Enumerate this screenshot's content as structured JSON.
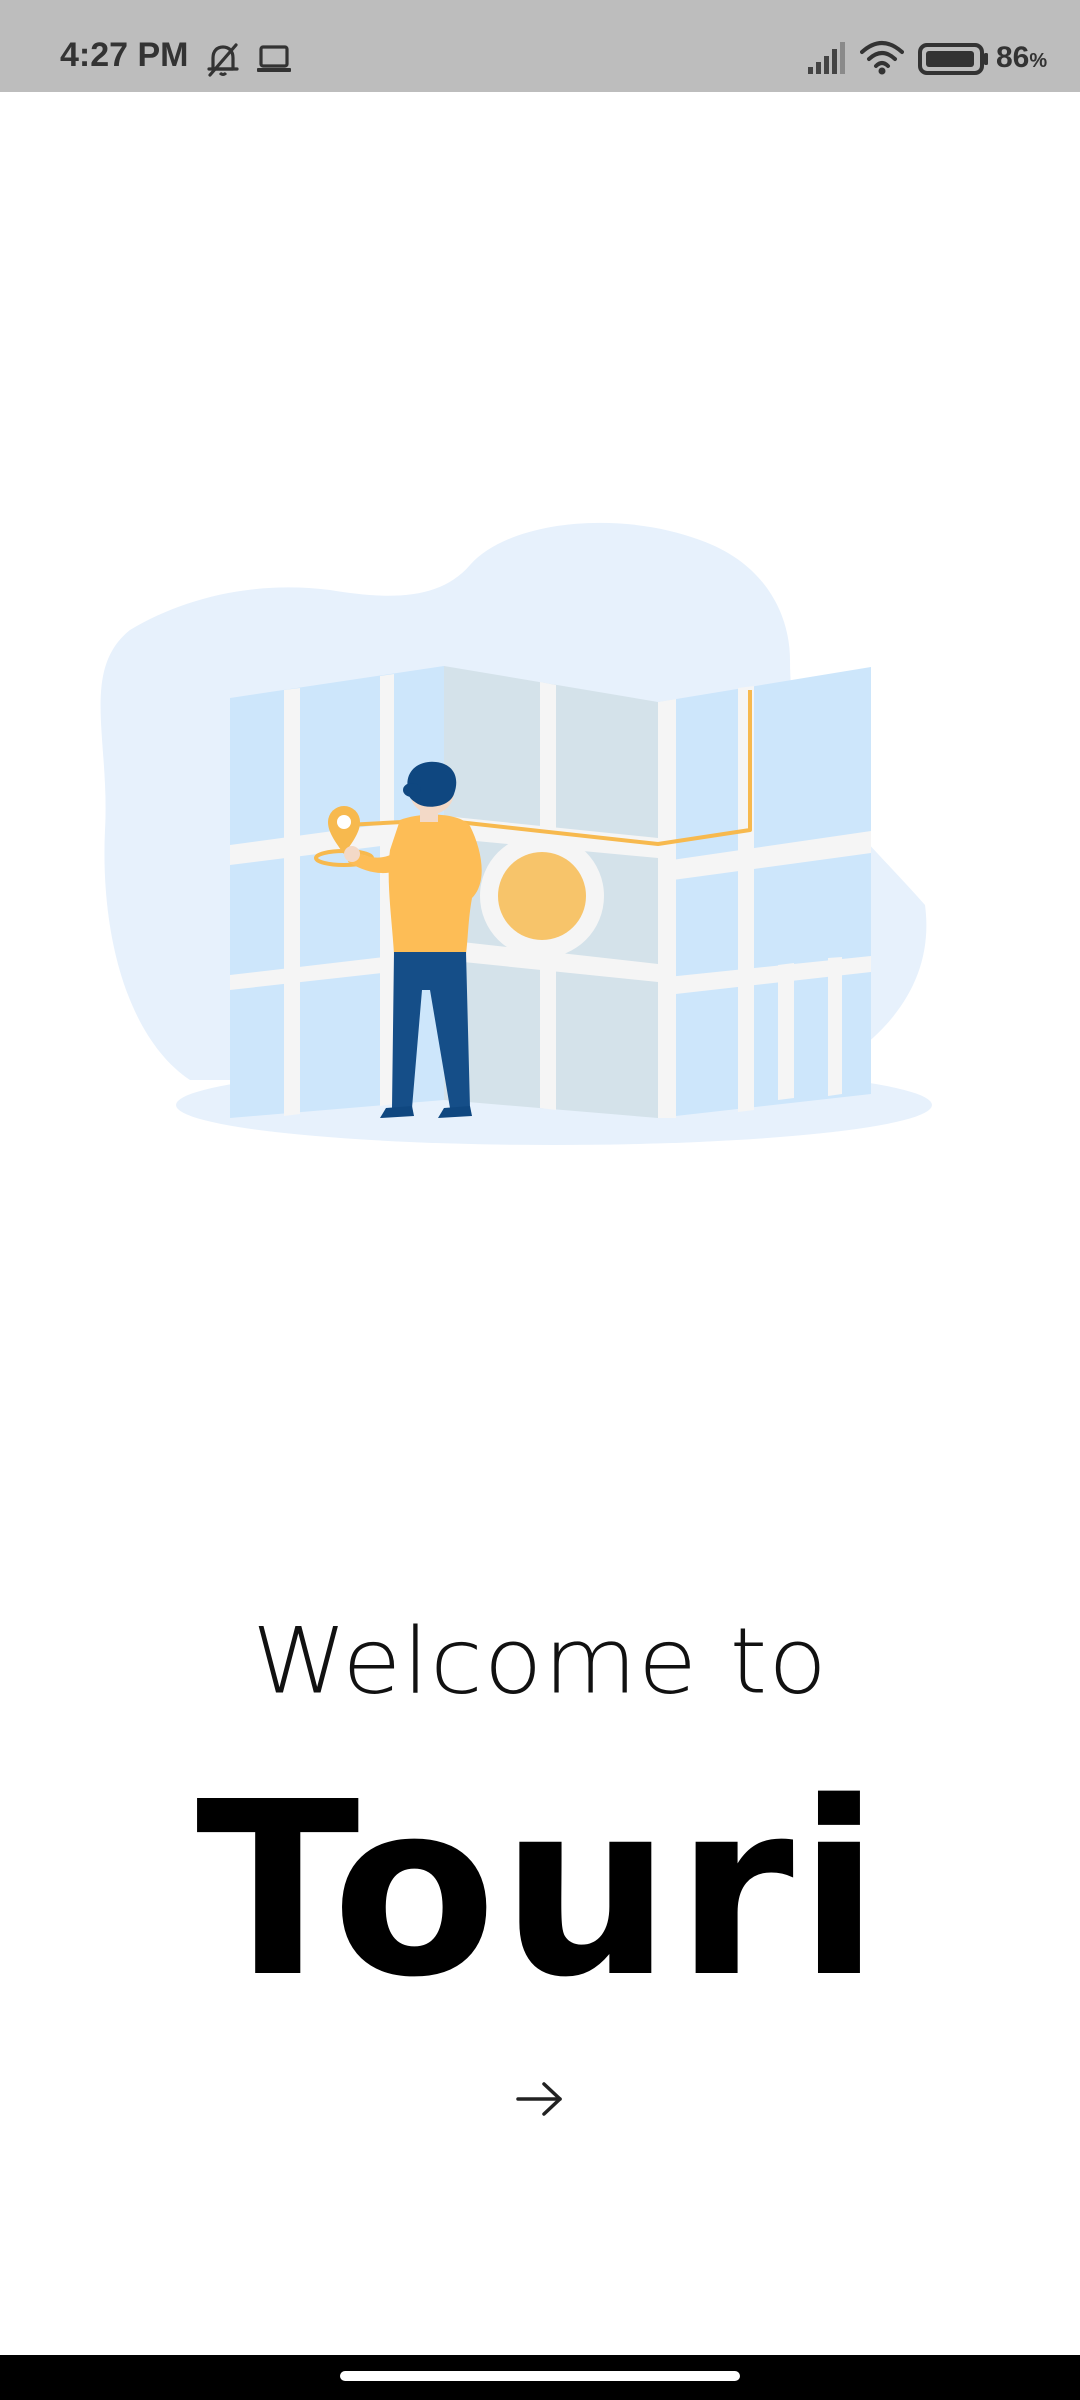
{
  "status_bar": {
    "time": "4:27 PM",
    "battery_percent": "86",
    "battery_percent_sign": "%",
    "icons": [
      "muted-bell-icon",
      "laptop-icon",
      "signal-icon",
      "wifi-icon",
      "battery-icon"
    ]
  },
  "illustration": {
    "icon": "map-with-person-illustration",
    "colors": {
      "blob": "#e7f1fc",
      "map_light": "#cde6fb",
      "map_dark": "#d4e2ea",
      "streets": "#f5f5f5",
      "route": "#f7b94e",
      "shirt": "#fdbd56",
      "pants": "#154e88",
      "hair": "#0f4780"
    }
  },
  "welcome": {
    "line1": "Welcome to",
    "brand": "Touri"
  },
  "next_button": {
    "icon": "arrow-right-icon"
  }
}
